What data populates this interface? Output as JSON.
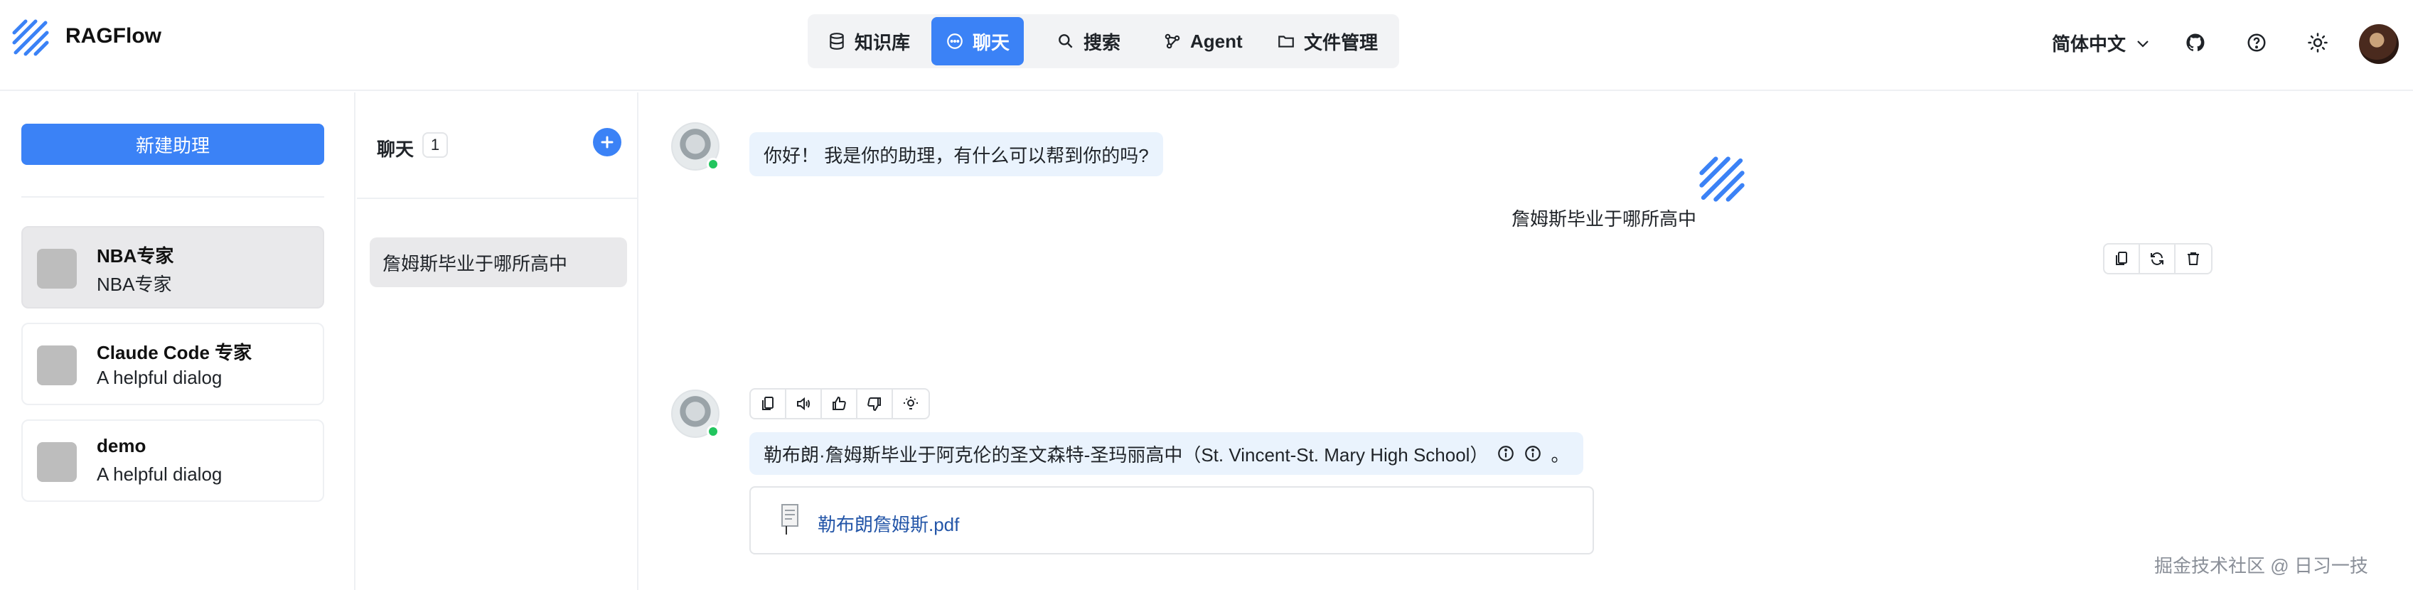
{
  "header": {
    "app_name": "RAGFlow",
    "nav": [
      {
        "label": "知识库",
        "icon": "database-icon",
        "active": false
      },
      {
        "label": "聊天",
        "icon": "chat-icon",
        "active": true
      },
      {
        "label": "搜索",
        "icon": "search-icon",
        "active": false
      },
      {
        "label": "Agent",
        "icon": "agent-icon",
        "active": false
      },
      {
        "label": "文件管理",
        "icon": "folder-icon",
        "active": false
      }
    ],
    "language": "简体中文",
    "icons": [
      "github-icon",
      "help-icon",
      "theme-icon"
    ]
  },
  "sidebar": {
    "new_button": "新建助理",
    "dialogs": [
      {
        "name": "NBA专家",
        "description": "NBA专家",
        "selected": true
      },
      {
        "name": "Claude Code 专家",
        "description": "A helpful dialog",
        "selected": false
      },
      {
        "name": "demo",
        "description": "A helpful dialog",
        "selected": false
      }
    ]
  },
  "conversations": {
    "title": "聊天",
    "count": "1",
    "items": [
      {
        "label": "詹姆斯毕业于哪所高中"
      }
    ]
  },
  "chat": {
    "greeting": "你好！ 我是你的助理，有什么可以帮到你的吗?",
    "user_message": "詹姆斯毕业于哪所高中",
    "answer": "勒布朗·詹姆斯毕业于阿克伦的圣文森特-圣玛丽高中（St. Vincent-St. Mary High School）",
    "answer_end": "。",
    "reference_file": "勒布朗詹姆斯.pdf"
  },
  "watermark": "掘金技术社区 @ 日习一技",
  "colors": {
    "accent": "#3b82f6",
    "bubble": "#eaf3fd",
    "online": "#22c55e",
    "link": "#2456a8"
  }
}
